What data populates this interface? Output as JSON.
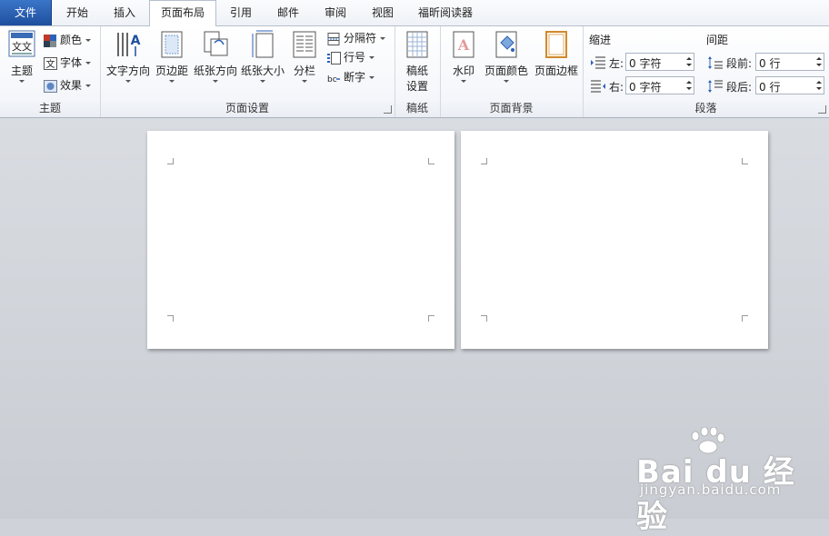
{
  "tabs": [
    "文件",
    "开始",
    "插入",
    "页面布局",
    "引用",
    "邮件",
    "审阅",
    "视图",
    "福昕阅读器"
  ],
  "active_tab": "页面布局",
  "groups": {
    "theme": {
      "label": "主题",
      "main_button": "主题",
      "theme_icon_text": "文文",
      "colors": "颜色",
      "fonts": "字体",
      "fonts_icon_text": "文",
      "effects": "效果"
    },
    "page_setup": {
      "label": "页面设置",
      "text_direction": "文字方向",
      "margins": "页边距",
      "orientation": "纸张方向",
      "size": "纸张大小",
      "columns": "分栏",
      "breaks": "分隔符",
      "line_numbers": "行号",
      "hyphenation": "断字",
      "hyphenation_icon_text": "bc",
      "text_direction_icon_text": "A"
    },
    "manuscript": {
      "label": "稿纸",
      "button_line1": "稿纸",
      "button_line2": "设置"
    },
    "page_background": {
      "label": "页面背景",
      "watermark": "水印",
      "watermark_icon_text": "A",
      "page_color": "页面颜色",
      "page_borders": "页面边框"
    },
    "paragraph": {
      "label": "段落",
      "indent_title": "缩进",
      "spacing_title": "间距",
      "indent_left_label": "左:",
      "indent_left_value": "0 字符",
      "indent_right_label": "右:",
      "indent_right_value": "0 字符",
      "space_before_label": "段前:",
      "space_before_value": "0 行",
      "space_after_label": "段后:",
      "space_after_value": "0 行"
    }
  },
  "watermark": {
    "logo": "Bai du 经验",
    "url": "jingyan.baidu.com"
  },
  "colors": {
    "file_tab": "#2b62b7",
    "ribbon_bg": "#f4f6fa",
    "doc_bg": "#cfd3d9"
  }
}
